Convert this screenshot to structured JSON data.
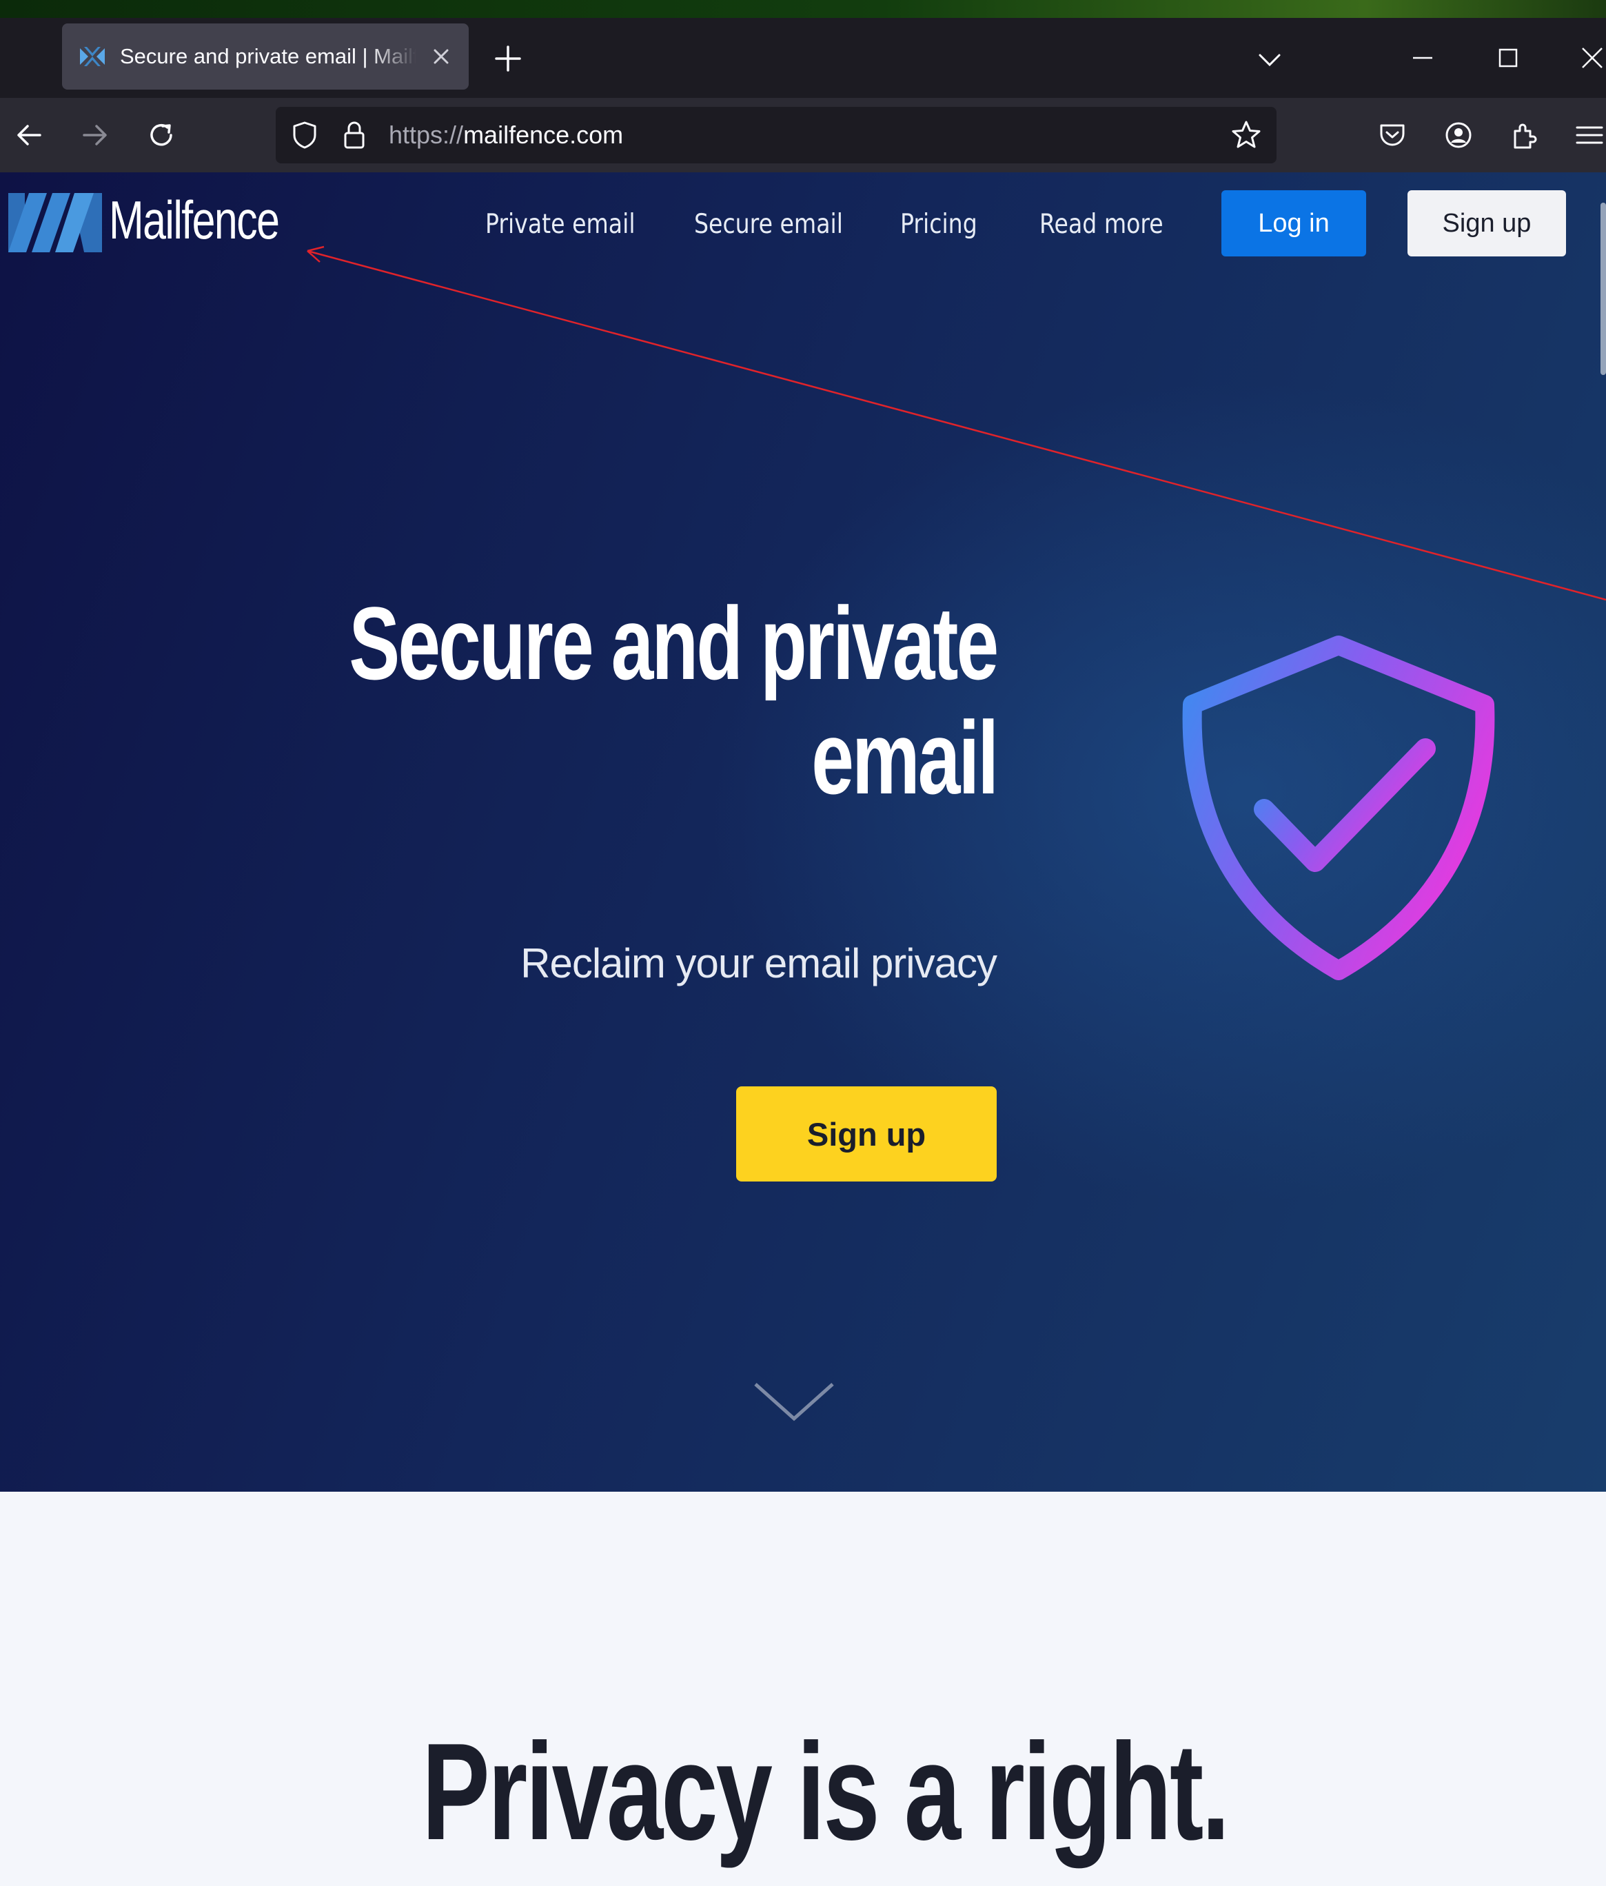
{
  "browser": {
    "tab": {
      "title": "Secure and private email | Mailfence",
      "favicon": "mailfence-favicon-icon",
      "close_icon": "close-icon"
    },
    "new_tab_icon": "plus-icon",
    "list_tabs_icon": "chevron-down-icon",
    "window_controls": [
      "minimize-icon",
      "maximize-icon",
      "close-icon"
    ],
    "nav_icons": [
      "back-arrow-icon",
      "forward-arrow-icon",
      "reload-icon"
    ],
    "url": {
      "scheme": "https://",
      "host": "mailfence.com"
    },
    "url_icons": [
      "tracking-shield-icon",
      "lock-icon",
      "bookmark-star-icon"
    ],
    "toolbar_icons": [
      "pocket-icon",
      "account-icon",
      "extensions-icon",
      "menu-icon"
    ]
  },
  "site": {
    "logo_text": "Mailfence",
    "nav": {
      "links": [
        "Private email",
        "Secure email",
        "Pricing",
        "Read more"
      ],
      "login_label": "Log in",
      "signup_label": "Sign up"
    },
    "hero": {
      "title_line1": "Secure and private",
      "title_line2": "email",
      "subtitle": "Reclaim your email privacy",
      "cta_label": "Sign up",
      "illustration": "shield-check-icon",
      "scroll_icon": "chevron-down-icon"
    },
    "section2": {
      "title": "Privacy is a right."
    }
  },
  "colors": {
    "hero_bg_start": "#0e1245",
    "hero_bg_end": "#183d6c",
    "login_button": "#0b74e5",
    "cta_button": "#fdd21f",
    "section2_bg": "#f4f6fb",
    "annotation_arrow": "#e0232a"
  }
}
